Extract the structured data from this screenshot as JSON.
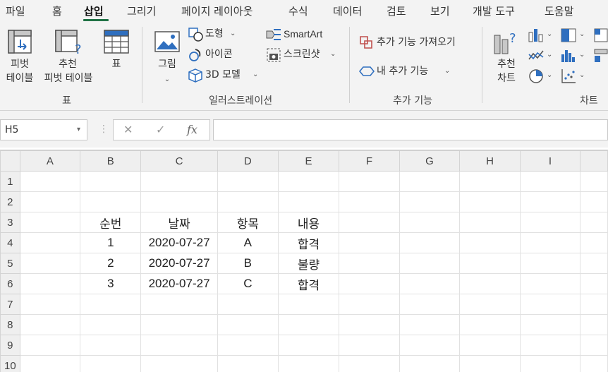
{
  "tabs": [
    "파일",
    "홈",
    "삽입",
    "그리기",
    "페이지 레이아웃",
    "수식",
    "데이터",
    "검토",
    "보기",
    "개발 도구",
    "도움말"
  ],
  "active_tab": "삽입",
  "ribbon": {
    "pivot_line1": "피벗",
    "pivot_line2": "테이블",
    "rec_pivot_line1": "추천",
    "rec_pivot_line2": "피벗 테이블",
    "table": "표",
    "group_tables": "표",
    "pictures": "그림",
    "shapes": "도형",
    "icons": "아이콘",
    "models3d": "3D 모델",
    "smartart": "SmartArt",
    "screenshot": "스크린샷",
    "group_illustrations": "일러스트레이션",
    "get_addins": "추가 기능 가져오기",
    "my_addins": "내 추가 기능",
    "group_addins": "추가 기능",
    "rec_charts_line1": "추천",
    "rec_charts_line2": "차트",
    "group_charts": "차트"
  },
  "formula_bar": {
    "name_box": "H5",
    "fx": "fx",
    "cancel": "✕",
    "enter": "✓",
    "formula": ""
  },
  "sheet": {
    "columns": [
      "A",
      "B",
      "C",
      "D",
      "E",
      "F",
      "G",
      "H",
      "I"
    ],
    "rows": [
      [
        "",
        "",
        "",
        "",
        "",
        "",
        "",
        "",
        ""
      ],
      [
        "",
        "",
        "",
        "",
        "",
        "",
        "",
        "",
        ""
      ],
      [
        "",
        "순번",
        "날짜",
        "항목",
        "내용",
        "",
        "",
        "",
        ""
      ],
      [
        "",
        "1",
        "2020-07-27",
        "A",
        "합격",
        "",
        "",
        "",
        ""
      ],
      [
        "",
        "2",
        "2020-07-27",
        "B",
        "불량",
        "",
        "",
        "",
        ""
      ],
      [
        "",
        "3",
        "2020-07-27",
        "C",
        "합격",
        "",
        "",
        "",
        ""
      ],
      [
        "",
        "",
        "",
        "",
        "",
        "",
        "",
        "",
        ""
      ],
      [
        "",
        "",
        "",
        "",
        "",
        "",
        "",
        "",
        ""
      ],
      [
        "",
        "",
        "",
        "",
        "",
        "",
        "",
        "",
        ""
      ],
      [
        "",
        "",
        "",
        "",
        "",
        "",
        "",
        "",
        ""
      ]
    ],
    "row_numbers": [
      "1",
      "2",
      "3",
      "4",
      "5",
      "6",
      "7",
      "8",
      "9",
      "10"
    ]
  },
  "colors": {
    "accent": "#217346"
  }
}
